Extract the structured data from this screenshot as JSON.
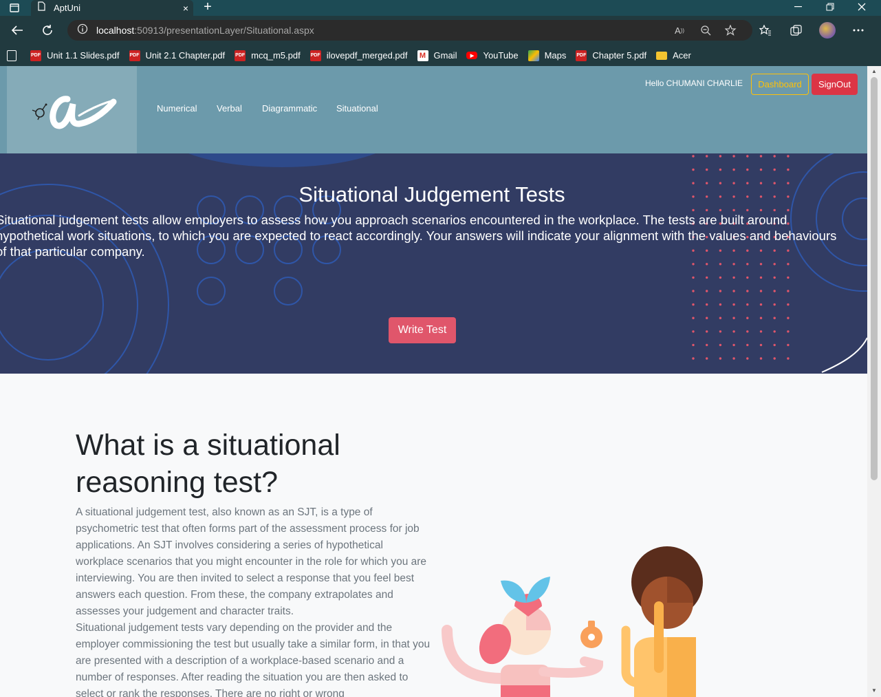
{
  "browser": {
    "tab_title": "AptUni",
    "tab_close": "×",
    "new_tab": "+",
    "url_host": "localhost",
    "url_path": ":50913/presentationLayer/Situational.aspx",
    "bookmarks": [
      {
        "label": "Unit 1.1 Slides.pdf",
        "icon": "pdf-icon"
      },
      {
        "label": "Unit 2.1 Chapter.pdf",
        "icon": "pdf-icon"
      },
      {
        "label": "mcq_m5.pdf",
        "icon": "pdf-icon"
      },
      {
        "label": "ilovepdf_merged.pdf",
        "icon": "pdf-icon"
      },
      {
        "label": "Gmail",
        "icon": "gmail-icon"
      },
      {
        "label": "YouTube",
        "icon": "youtube-icon"
      },
      {
        "label": "Maps",
        "icon": "maps-icon"
      },
      {
        "label": "Chapter 5.pdf",
        "icon": "pdf-icon"
      },
      {
        "label": "Acer",
        "icon": "folder-icon"
      }
    ]
  },
  "header": {
    "nav": [
      "Numerical",
      "Verbal",
      "Diagrammatic",
      "Situational"
    ],
    "greeting": "Hello CHUMANI CHARLIE",
    "dashboard_label": "Dashboard",
    "signout_label": "SignOut"
  },
  "hero": {
    "title": "Situational Judgement Tests",
    "text": "Situational judgement tests allow employers to assess how you approach scenarios encountered in the workplace. The tests are built around hypothetical work situations, to which you are expected to react accordingly. Your answers will indicate your alignment with the values and behaviours of that particular company.",
    "button": "Write Test"
  },
  "content": {
    "title": "What is a situational reasoning test?",
    "paragraph1": "A situational judgement test, also known as an SJT, is a type of psychometric test that often forms part of the assessment process for job applications. An SJT involves considering a series of hypothetical workplace scenarios that you might encounter in the role for which you are interviewing. You are then invited to select a response that you feel best answers each question. From these, the company extrapolates and assesses your judgement and character traits.",
    "paragraph2": "Situational judgement tests vary depending on the provider and the employer commissioning the test but usually take a similar form, in that you are presented with a description of a workplace-based scenario and a number of responses. After reading the situation you are then asked to select or rank the responses. There are no right or wrong"
  },
  "colors": {
    "header_bg": "#6c9aab",
    "hero_bg": "#323c63",
    "accent_red": "#e0566b",
    "signout_red": "#dc3545",
    "dashboard_yellow": "#ffc107"
  }
}
